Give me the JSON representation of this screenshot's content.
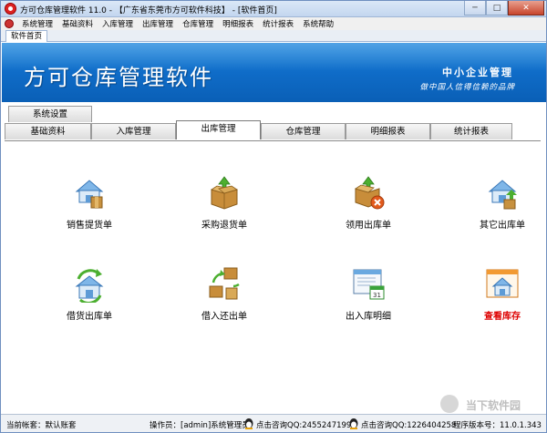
{
  "window": {
    "title": "方可仓库管理软件 11.0 - 【广东省东莞市方可软件科技】 - [软件首页]",
    "minimize": "─",
    "maximize": "□",
    "close": "✕"
  },
  "menubar": {
    "items": [
      "系统管理",
      "基础资料",
      "入库管理",
      "出库管理",
      "仓库管理",
      "明细报表",
      "统计报表",
      "系统帮助"
    ]
  },
  "doc_tabs": [
    "软件首页"
  ],
  "banner": {
    "app_name": "方可仓库管理软件",
    "slogan1": "中小企业管理",
    "slogan2": "做中国人信得信赖的品牌"
  },
  "func_tabs": {
    "row1": [
      "系统设置"
    ],
    "row2": [
      "基础资料",
      "入库管理",
      "出库管理",
      "仓库管理",
      "明细报表",
      "统计报表"
    ],
    "active": "出库管理"
  },
  "tiles": [
    {
      "label": "销售提货单",
      "icon": "house-box-icon"
    },
    {
      "label": "采购退货单",
      "icon": "open-box-arrow-icon"
    },
    {
      "label": "领用出库单",
      "icon": "box-cancel-icon"
    },
    {
      "label": "其它出库单",
      "icon": "house-box-icon"
    },
    {
      "label": "借货出库单",
      "icon": "house-refresh-icon"
    },
    {
      "label": "借入还出单",
      "icon": "boxes-cycle-icon"
    },
    {
      "label": "出入库明细",
      "icon": "calendar-window-icon"
    },
    {
      "label": "查看库存",
      "icon": "window-house-icon",
      "highlight": true
    }
  ],
  "status": {
    "account": "当前帐套：默认账套",
    "operator": "操作员：[admin]系统管理员",
    "qq1": "点击咨询QQ:2455247199",
    "qq2": "点击咨询QQ:1226404258",
    "version": "程序版本号：11.0.1.343"
  },
  "watermark": "当下软件园",
  "colors": {
    "banner": "#0f6cc8",
    "highlight_label": "#dd0000"
  }
}
